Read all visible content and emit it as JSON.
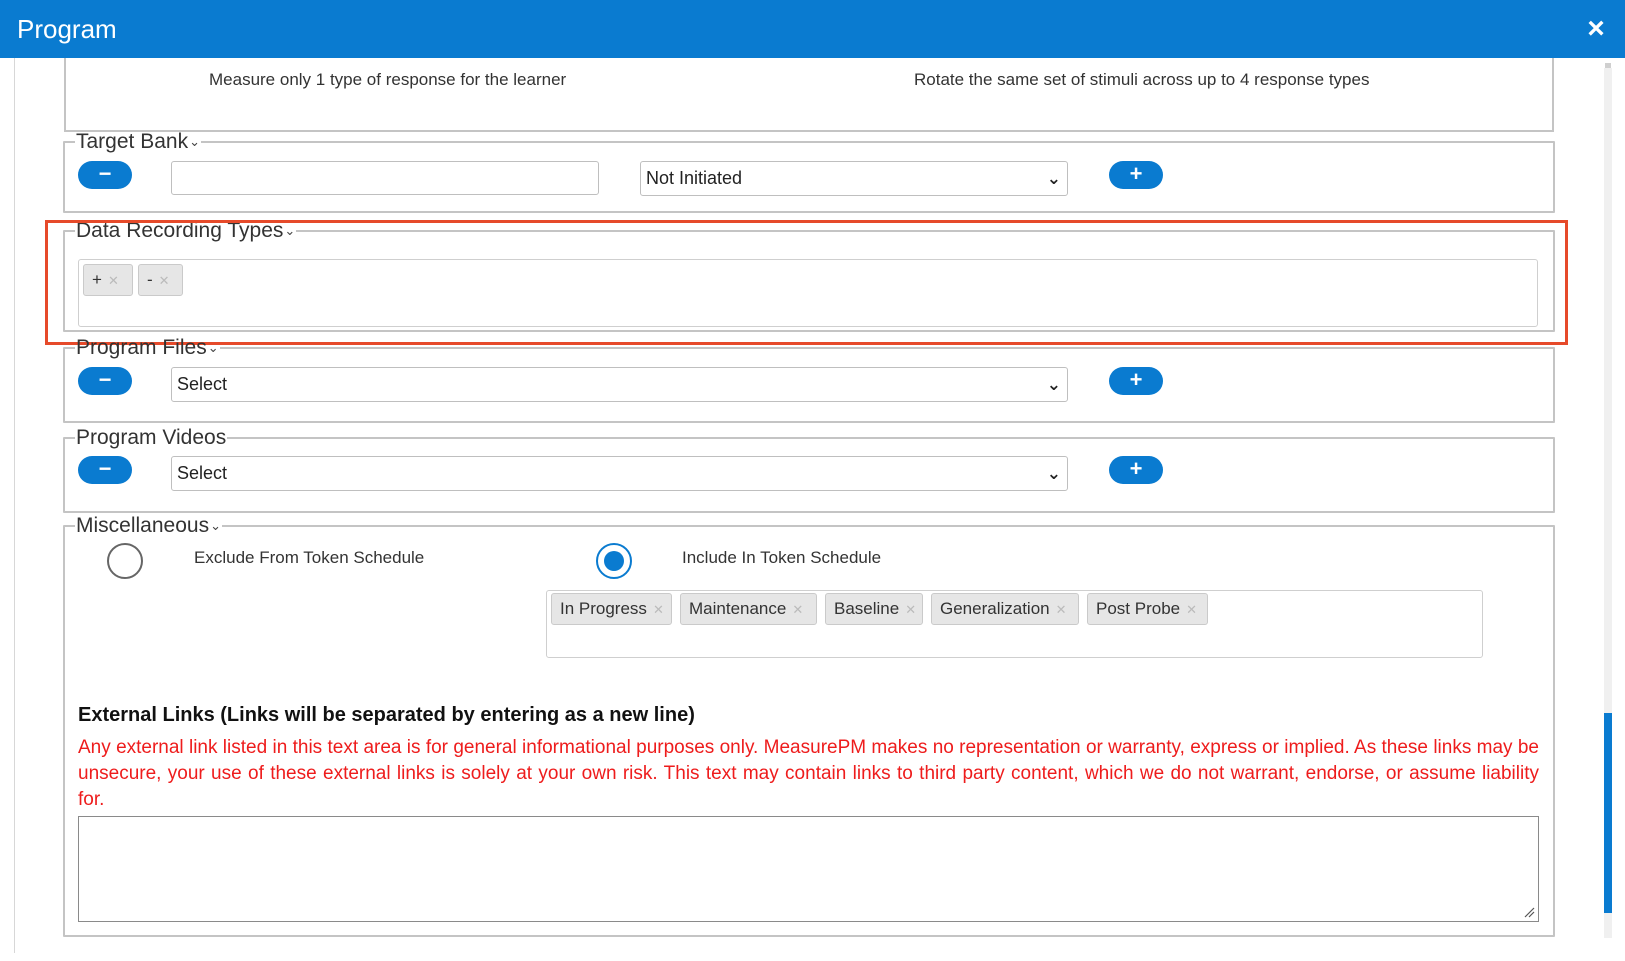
{
  "dialog": {
    "title": "Program",
    "close_icon": "×"
  },
  "response_types": {
    "option_single": "Measure only 1 type of response for the learner",
    "option_rotate": "Rotate the same set of stimuli across up to 4 response types"
  },
  "target_bank": {
    "legend": "Target Bank",
    "remove_label": "−",
    "add_label": "+",
    "text_value": "",
    "status_selected": "Not Initiated"
  },
  "data_recording_types": {
    "legend": "Data Recording Types",
    "chips": [
      {
        "label": "+"
      },
      {
        "label": "-"
      }
    ]
  },
  "program_files": {
    "legend": "Program Files",
    "remove_label": "−",
    "add_label": "+",
    "selected": "Select"
  },
  "program_videos": {
    "legend": "Program Videos",
    "remove_label": "−",
    "add_label": "+",
    "selected": "Select"
  },
  "miscellaneous": {
    "legend": "Miscellaneous",
    "exclude_label": "Exclude From Token Schedule",
    "include_label": "Include In Token Schedule",
    "selected": "include",
    "chips": [
      {
        "label": "In Progress"
      },
      {
        "label": "Maintenance"
      },
      {
        "label": "Baseline"
      },
      {
        "label": "Generalization"
      },
      {
        "label": "Post Probe"
      }
    ]
  },
  "external_links": {
    "heading": "External Links (Links will be separated by entering as a new line)",
    "warning": "Any external link listed in this text area is for general informational purposes only. MeasurePM makes no representation or warranty, express or implied. As these links may be unsecure, your use of these external links is solely at your own risk. This text may contain links to third party content, which we do not warrant, endorse, or assume liability for.",
    "value": ""
  },
  "icons": {
    "chevron": "⌄",
    "caret": "⌄",
    "chip_remove": "✕"
  },
  "colors": {
    "primary": "#0a7bd0",
    "highlight": "#e64a2a",
    "warning": "#ee1c1c"
  }
}
